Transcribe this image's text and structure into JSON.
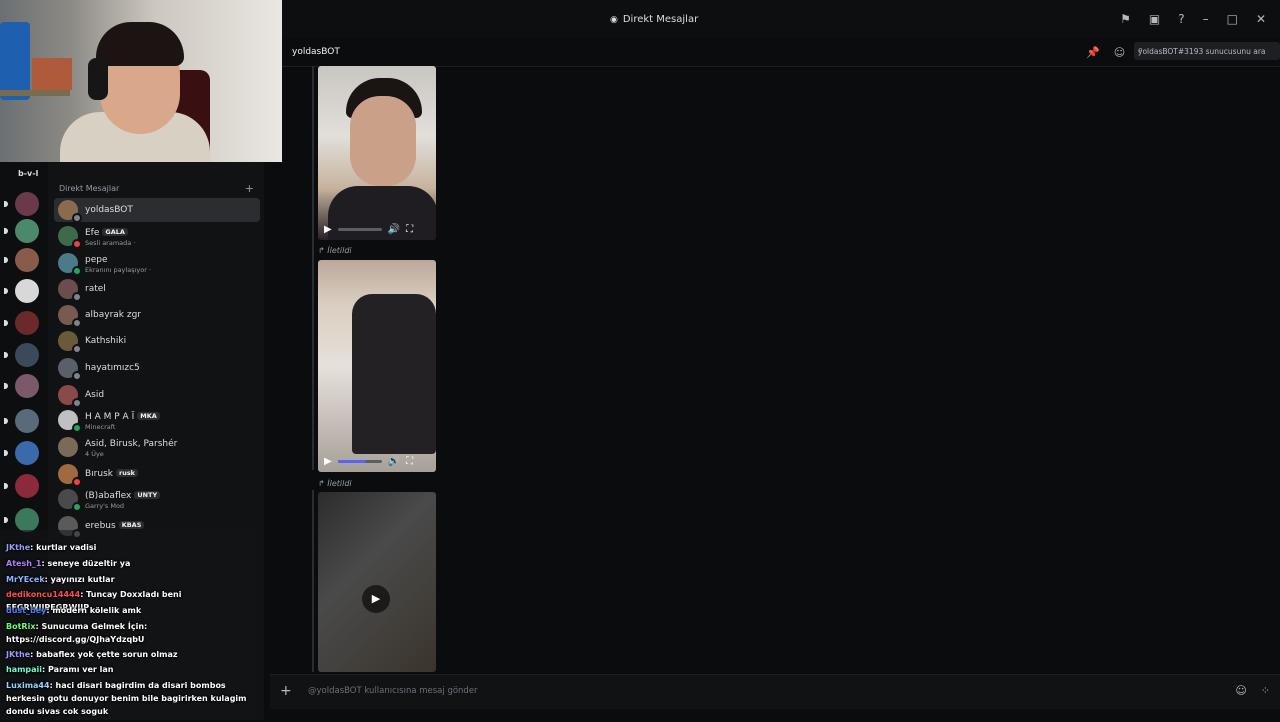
{
  "window": {
    "title": "Direkt Mesajlar"
  },
  "server_folder_label": "b-v-l",
  "dm_panel": {
    "header": "Direkt Mesajlar",
    "items": [
      {
        "name": "yoldasBOT",
        "sub": "",
        "tag": "",
        "selected": true,
        "color": "#8a6a50",
        "status": "#80848e"
      },
      {
        "name": "Efe",
        "sub": "Sesli aramada ·",
        "tag": "GALA",
        "color": "#3d6b4a",
        "status": "#f23f43"
      },
      {
        "name": "pepe",
        "sub": "Ekranını paylaşıyor ·",
        "tag": "",
        "color": "#4b7a8a",
        "status": "#23a55a"
      },
      {
        "name": "ratel",
        "sub": "",
        "tag": "",
        "color": "#6b4d4d",
        "status": "#80848e"
      },
      {
        "name": "albayrak zgr",
        "sub": "",
        "tag": "",
        "color": "#7a5a50",
        "status": "#80848e"
      },
      {
        "name": "Kathshiki",
        "sub": "",
        "tag": "",
        "color": "#6a5a3a",
        "status": "#80848e"
      },
      {
        "name": "hayatımızc5",
        "sub": "",
        "tag": "",
        "color": "#5a5f6a",
        "status": "#80848e"
      },
      {
        "name": "Asid",
        "sub": "",
        "tag": "",
        "color": "#8a4a4a",
        "status": "#80848e"
      },
      {
        "name": "H A M P A Ï",
        "sub": "Minecraft",
        "tag": "MKA",
        "color": "#c0c0c0",
        "status": "#23a55a"
      },
      {
        "name": "Asid, Birusk, Parshér",
        "sub": "4 Üye",
        "tag": "",
        "color": "#7a6a5a",
        "status": ""
      },
      {
        "name": "Bırusk",
        "sub": "",
        "tag": "rusk",
        "color": "#a06a40",
        "status": "#f23f43"
      },
      {
        "name": "(B)abaflex",
        "sub": "Garry's Mod",
        "tag": "UNTY",
        "color": "#4a4a4a",
        "status": "#23a55a"
      },
      {
        "name": "erebus",
        "sub": "",
        "tag": "KBAS",
        "color": "#5a5a5a",
        "status": "#80848e"
      }
    ]
  },
  "channel": {
    "name": "yoldasBOT",
    "search_placeholder": "yoldasBOT#3193 sunucusunu ara",
    "forwarded_label": "İletildi"
  },
  "videos": [
    {
      "progress": 0.0,
      "volume": 0.0
    },
    {
      "progress": 0.0,
      "volume": 0.65
    },
    {
      "progress": 0.0,
      "volume": 0.0
    }
  ],
  "composer": {
    "placeholder": "@yoldasBOT kullanıcısına mesaj gönder"
  },
  "chat": [
    {
      "user": "JKthe",
      "color": "#9b9bff",
      "msg": "kurtlar vadisi"
    },
    {
      "user": "Atesh_1",
      "color": "#b07dff",
      "msg": "seneye düzeltir ya"
    },
    {
      "user": "MrYEcek",
      "color": "#8ab4ff",
      "msg": "yayınızı kutlar"
    },
    {
      "user": "dedikoncu14444",
      "color": "#ff4d4d",
      "msg": "Tuncay Doxxladı beni EFGRWIJPEGRWIJP"
    },
    {
      "user": "dust_bey",
      "color": "#4d7dff",
      "msg": "modern kölelik amk"
    },
    {
      "user": "BotRix",
      "color": "#6bff6b",
      "msg": "Sunucuma Gelmek İçin: https://discord.gg/QJhaYdzqbU"
    },
    {
      "user": "JKthe",
      "color": "#9b9bff",
      "msg": "babaflex yok çette sorun olmaz"
    },
    {
      "user": "hampaii",
      "color": "#6bffd0",
      "msg": "Paramı ver lan"
    },
    {
      "user": "Luxima44",
      "color": "#9bd0ff",
      "msg": "haci disari bagirdim da disari bombos herkesin gotu donuyor benim bile bagirirken kulagim dondu sivas cok soguk"
    }
  ]
}
